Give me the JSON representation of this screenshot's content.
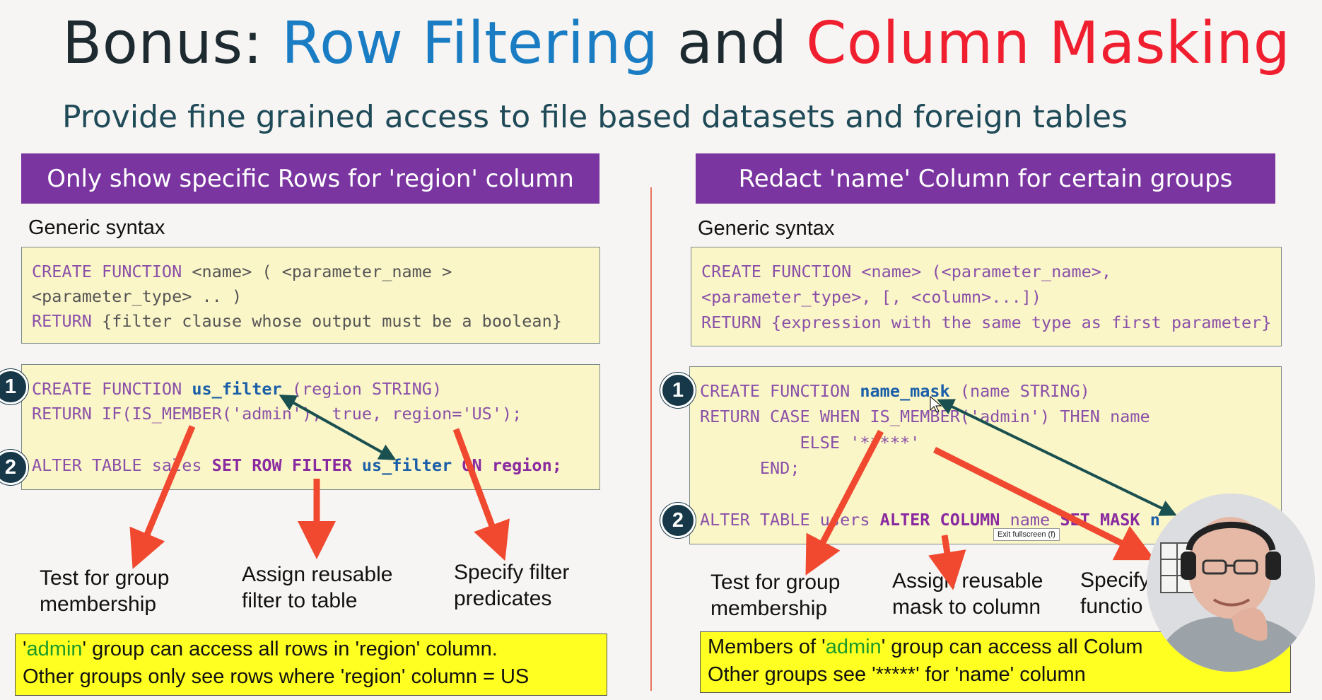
{
  "title": {
    "prefix": "Bonus: ",
    "part1": "Row Filtering",
    "mid": " and ",
    "part2": "Column Masking"
  },
  "subtitle": "Provide fine grained access to file based datasets and foreign tables",
  "left": {
    "banner": "Only show specific Rows for 'region' column",
    "generic_label": "Generic syntax",
    "generic_code": {
      "l1a": "CREATE FUNCTION ",
      "l1b": "<name> ( <parameter_name >",
      "l2": "<parameter_type> .. )",
      "l3a": "RETURN ",
      "l3b": "{filter clause whose output must be a boolean}"
    },
    "example_code": {
      "l1a": "CREATE FUNCTION ",
      "l1fn": "us_filter",
      "l1b": " (region STRING)",
      "l2": "RETURN IF(IS_MEMBER('admin'), true, region='US');",
      "l3a": "ALTER TABLE sales ",
      "l3kw": "SET ROW FILTER ",
      "l3fn": "us_filter",
      "l3b": " ON region;"
    },
    "badge1": "1",
    "badge2": "2",
    "captions": [
      {
        "line1": "Test for group",
        "line2": "membership"
      },
      {
        "line1": "Assign reusable",
        "line2": "filter to table"
      },
      {
        "line1": "Specify filter",
        "line2": "predicates"
      }
    ],
    "note": {
      "q1": "'",
      "grp": "admin",
      "q2": "' group can access all rows in 'region' column.",
      "line2": "Other groups only see rows where 'region' column = US"
    }
  },
  "right": {
    "banner": "Redact 'name' Column for certain groups",
    "generic_label": "Generic syntax",
    "generic_code": {
      "l1a": "CREATE FUNCTION ",
      "l1b": "<name> (<parameter_name>,",
      "l2": "<parameter_type>, [, <column>...])",
      "l3a": "RETURN ",
      "l3b": "{expression with the same type as first parameter}"
    },
    "example_code": {
      "l1a": "CREATE FUNCTION ",
      "l1fn": "name_mask",
      "l1b": " (name STRING)",
      "l2": "RETURN CASE WHEN IS_MEMBER('admin') THEN name",
      "l3": "          ELSE '*****'",
      "l4": "      END;",
      "l5a": "ALTER TABLE users ",
      "l5kw": "ALTER COLUMN ",
      "l5b": "name ",
      "l5kw2": "SET MASK ",
      "l5fn": "n"
    },
    "badge1": "1",
    "badge2": "2",
    "captions": [
      {
        "line1": "Test for group",
        "line2": "membership"
      },
      {
        "line1": "Assign reusable",
        "line2": "mask to column"
      },
      {
        "line1": "Specify",
        "line2": "functio"
      }
    ],
    "note": {
      "q1": "Members of '",
      "grp": "admin",
      "q2": "' group can access all Colum",
      "line2": "Other groups see '*****' for 'name' column"
    }
  },
  "tooltip": "Exit fullscreen (f)",
  "colors": {
    "banner": "#7a35a0",
    "arrow": "#f0492f",
    "badge": "#163848",
    "note": "#ffff22",
    "code_bg": "#fbf6c8"
  }
}
